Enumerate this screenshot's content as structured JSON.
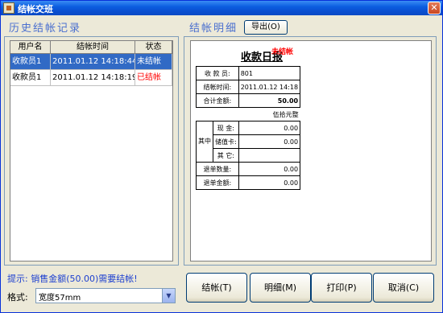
{
  "window": {
    "title": "结帐交班",
    "close_symbol": "✕"
  },
  "history": {
    "title": "历史结帐记录",
    "columns": [
      "用户名",
      "结帐时间",
      "状态"
    ],
    "rows": [
      {
        "user": "收款员1",
        "time": "2011.01.12 14:18:44",
        "status": "未结帐",
        "selected": true
      },
      {
        "user": "收款员1",
        "time": "2011.01.12 14:18:19",
        "status": "已结帐",
        "selected": false
      }
    ]
  },
  "detail": {
    "title": "结帐明细",
    "export_label": "导出(O)"
  },
  "report": {
    "title": "收款日报",
    "status": "未结帐",
    "cashier_label": "收 款 员:",
    "cashier_value": "801",
    "time_label": "结帐时间:",
    "time_value": "2011.01.12 14:18",
    "total_label": "合计金额:",
    "total_value": "50.00",
    "total_words": "伍拾元整",
    "breakdown_label": "其中",
    "cash_label": "现 金:",
    "cash_value": "0.00",
    "card_label": "储值卡:",
    "card_value": "0.00",
    "other_label": "其 它:",
    "other_value": "",
    "returns_qty_label": "退单数量:",
    "returns_qty_value": "0.00",
    "returns_amt_label": "退单金额:",
    "returns_amt_value": "0.00"
  },
  "footer": {
    "hint": "提示: 销售金额(50.00)需要结帐!",
    "format_label": "格式:",
    "format_value": "宽度57mm",
    "buttons": {
      "checkout": "结帐(T)",
      "detail": "明细(M)",
      "print": "打印(P)",
      "cancel": "取消(C)"
    }
  },
  "colors": {
    "accent": "#4a6fcf",
    "selection": "#316ac5",
    "status_red": "#ff0000",
    "hint": "#1c3fd0"
  }
}
